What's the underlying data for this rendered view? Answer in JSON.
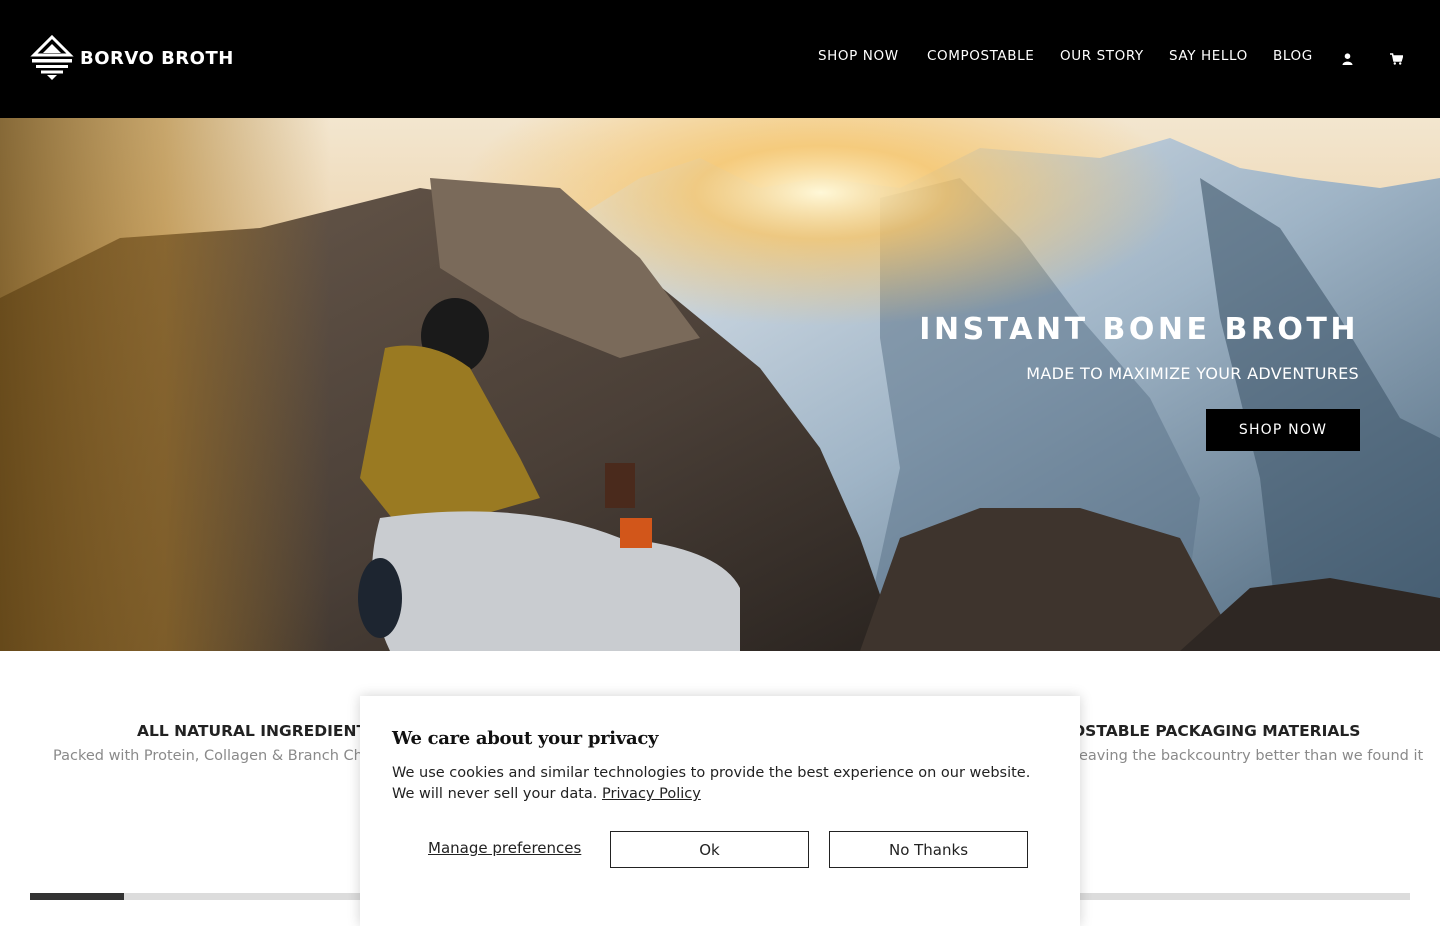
{
  "brand": {
    "name": "BORVO BROTH",
    "logo_icon": "mountain-logo-icon"
  },
  "nav": {
    "items": [
      {
        "label": "SHOP NOW"
      },
      {
        "label": "COMPOSTABLE"
      },
      {
        "label": "OUR STORY"
      },
      {
        "label": "SAY HELLO"
      },
      {
        "label": "BLOG"
      }
    ],
    "account_icon": "user-icon",
    "cart_icon": "cart-icon"
  },
  "hero": {
    "title": "INSTANT BONE BROTH",
    "subtitle": "MADE TO MAXIMIZE YOUR ADVENTURES",
    "cta_label": "SHOP NOW"
  },
  "features": [
    {
      "title": "ALL NATURAL INGREDIENTS",
      "subtitle": "Packed with Protein, Collagen & Branch Chain A"
    },
    {
      "title": "OSTABLE PACKAGING MATERIALS",
      "subtitle": "eaving the backcountry better than we found it"
    }
  ],
  "carousel": {
    "progress": 0.068
  },
  "cookie_banner": {
    "title": "We care about your privacy",
    "body": "We use cookies and similar technologies to provide the best experience on our website. We will never sell your data.",
    "privacy_link": "Privacy Policy",
    "manage_label": "Manage preferences",
    "ok_label": "Ok",
    "no_thanks_label": "No Thanks"
  },
  "colors": {
    "header_bg": "#000000",
    "button_bg": "#000000",
    "text_light": "#ffffff",
    "muted_text": "#8a8a8a"
  }
}
